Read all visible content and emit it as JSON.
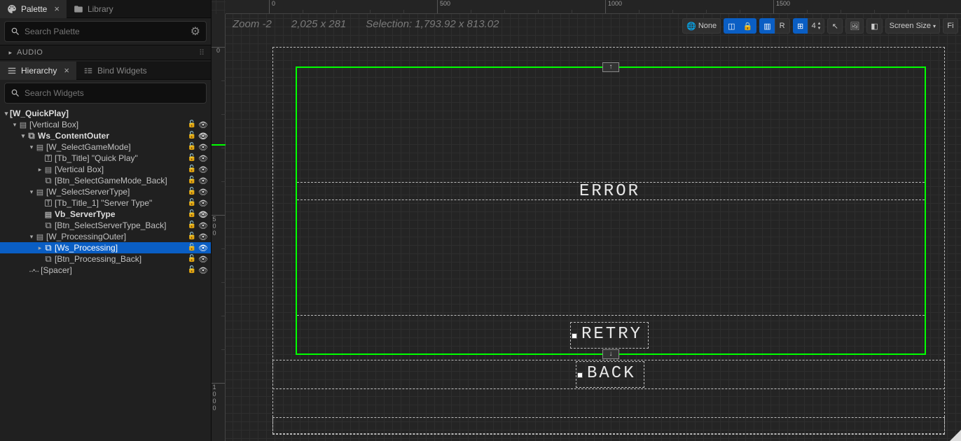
{
  "tabs": {
    "palette": "Palette",
    "library": "Library",
    "hierarchy": "Hierarchy",
    "bind_widgets": "Bind Widgets"
  },
  "search": {
    "palette_ph": "Search Palette",
    "widgets_ph": "Search Widgets"
  },
  "palette_category": "AUDIO",
  "tree": {
    "root": "[W_QuickPlay]",
    "vbox": "[Vertical Box]",
    "ws_content_outer": "Ws_ContentOuter",
    "w_select_game_mode": "[W_SelectGameMode]",
    "tb_title": "[Tb_Title] \"Quick Play\"",
    "vbox2": "[Vertical Box]",
    "btn_sgm_back": "[Btn_SelectGameMode_Back]",
    "w_select_server_type": "[W_SelectServerType]",
    "tb_title1": "[Tb_Title_1] \"Server Type\"",
    "vb_server_type": "Vb_ServerType",
    "btn_sst_back": "[Btn_SelectServerType_Back]",
    "w_processing_outer": "[W_ProcessingOuter]",
    "ws_processing": "[Ws_Processing]",
    "btn_processing_back": "[Btn_Processing_Back]",
    "spacer": "[Spacer]"
  },
  "status": {
    "zoom": "Zoom -2",
    "size": "2,025 x 281",
    "selection": "Selection: 1,793.92 x 813.02"
  },
  "toolbar": {
    "none": "None",
    "r": "R",
    "count": "4",
    "screen_size": "Screen Size",
    "fi": "Fi"
  },
  "ruler": {
    "h": [
      "0",
      "500",
      "1000",
      "1500"
    ],
    "v": [
      "0",
      "500",
      "1000"
    ]
  },
  "canvas": {
    "error": "ERROR",
    "retry": "RETRY",
    "back": "BACK",
    "up": "↑",
    "down": "↓"
  }
}
